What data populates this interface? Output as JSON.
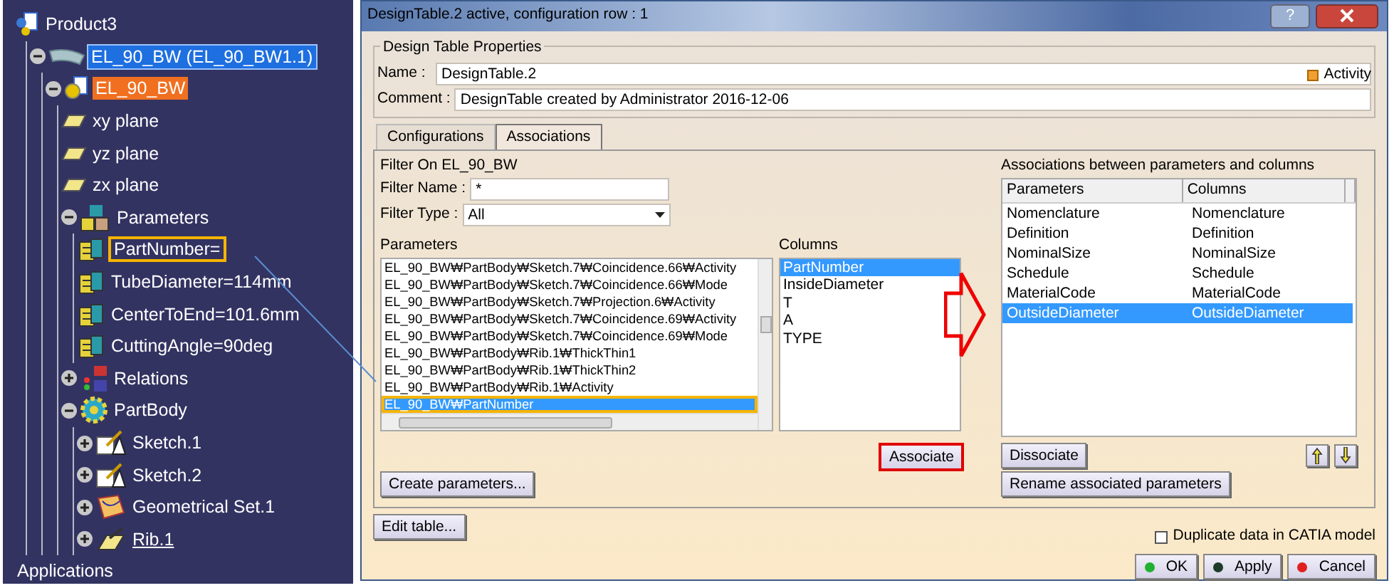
{
  "tree": [
    {
      "label": "Product3",
      "kind": "product",
      "selected": false,
      "highlighted": false,
      "children": [
        {
          "label": "EL_90_BW (EL_90_BW1.1)",
          "kind": "elbow",
          "expanded": true,
          "selected": true,
          "highlighted": false,
          "children": [
            {
              "label": "EL_90_BW",
              "kind": "part",
              "expanded": true,
              "selected": false,
              "highlighted": true,
              "children": [
                {
                  "label": "xy plane",
                  "kind": "plane",
                  "selected": false,
                  "highlighted": false
                },
                {
                  "label": "yz plane",
                  "kind": "plane",
                  "selected": false,
                  "highlighted": false
                },
                {
                  "label": "zx plane",
                  "kind": "plane",
                  "selected": false,
                  "highlighted": false
                },
                {
                  "label": "Parameters",
                  "kind": "parameters",
                  "expanded": true,
                  "selected": false,
                  "highlighted": false,
                  "children": [
                    {
                      "label": "PartNumber=",
                      "kind": "parameter",
                      "selected": false,
                      "highlighted": false,
                      "boxed": true
                    },
                    {
                      "label": "TubeDiameter=114mm",
                      "kind": "parameter",
                      "selected": false,
                      "highlighted": false
                    },
                    {
                      "label": "CenterToEnd=101.6mm",
                      "kind": "parameter",
                      "selected": false,
                      "highlighted": false
                    },
                    {
                      "label": "CuttingAngle=90deg",
                      "kind": "parameter",
                      "selected": false,
                      "highlighted": false
                    }
                  ]
                },
                {
                  "label": "Relations",
                  "kind": "relations",
                  "expanded": false,
                  "selected": false,
                  "highlighted": false
                },
                {
                  "label": "PartBody",
                  "kind": "body",
                  "expanded": true,
                  "selected": false,
                  "highlighted": false,
                  "children": [
                    {
                      "label": "Sketch.1",
                      "kind": "sketch",
                      "expanded": false,
                      "selected": false,
                      "highlighted": false
                    },
                    {
                      "label": "Sketch.2",
                      "kind": "sketch",
                      "expanded": false,
                      "selected": false,
                      "highlighted": false
                    },
                    {
                      "label": "Geometrical Set.1",
                      "kind": "geoset",
                      "expanded": false,
                      "selected": false,
                      "highlighted": false
                    },
                    {
                      "label": "Rib.1",
                      "kind": "rib",
                      "expanded": false,
                      "selected": false,
                      "highlighted": false,
                      "underlined": true
                    }
                  ]
                }
              ]
            }
          ]
        }
      ]
    },
    {
      "label": "Applications",
      "kind": "none",
      "selected": false,
      "highlighted": false
    }
  ],
  "dialog": {
    "title": "DesignTable.2 active, configuration row : 1",
    "help": "?",
    "properties": {
      "legend": "Design Table Properties",
      "name_label": "Name :",
      "name_value": "DesignTable.2",
      "comment_label": "Comment :",
      "comment_value": "DesignTable created by Administrator 2016-12-06",
      "activity": {
        "label": "Activity",
        "checked": true
      }
    },
    "tabs": [
      {
        "label": "Configurations",
        "selected": false
      },
      {
        "label": "Associations",
        "selected": true
      }
    ],
    "filter": {
      "caption": "Filter On EL_90_BW",
      "name_label": "Filter Name :",
      "name_value": "*",
      "type_label": "Filter Type :",
      "type_value": "All"
    },
    "parameters": {
      "label": "Parameters",
      "items": [
        {
          "text": "EL_90_BW₩PartBody₩Sketch.7₩Coincidence.66₩Activity",
          "selected": false,
          "boxed": false
        },
        {
          "text": "EL_90_BW₩PartBody₩Sketch.7₩Coincidence.66₩Mode",
          "selected": false,
          "boxed": false
        },
        {
          "text": "EL_90_BW₩PartBody₩Sketch.7₩Projection.6₩Activity",
          "selected": false,
          "boxed": false
        },
        {
          "text": "EL_90_BW₩PartBody₩Sketch.7₩Coincidence.69₩Activity",
          "selected": false,
          "boxed": false
        },
        {
          "text": "EL_90_BW₩PartBody₩Sketch.7₩Coincidence.69₩Mode",
          "selected": false,
          "boxed": false
        },
        {
          "text": "EL_90_BW₩PartBody₩Rib.1₩ThickThin1",
          "selected": false,
          "boxed": false
        },
        {
          "text": "EL_90_BW₩PartBody₩Rib.1₩ThickThin2",
          "selected": false,
          "boxed": false
        },
        {
          "text": "EL_90_BW₩PartBody₩Rib.1₩Activity",
          "selected": false,
          "boxed": false
        },
        {
          "text": "EL_90_BW₩PartNumber",
          "selected": true,
          "boxed": true
        }
      ]
    },
    "columns": {
      "label": "Columns",
      "items": [
        {
          "text": "PartNumber",
          "selected": true
        },
        {
          "text": "InsideDiameter",
          "selected": false
        },
        {
          "text": "T",
          "selected": false
        },
        {
          "text": "A",
          "selected": false
        },
        {
          "text": "TYPE",
          "selected": false
        }
      ]
    },
    "associate_button": {
      "label": "Associate",
      "boxed": true
    },
    "create_button": "Create parameters...",
    "associations": {
      "label": "Associations between parameters and columns",
      "headers": [
        "Parameters",
        "Columns"
      ],
      "rows": [
        {
          "parameter": "Nomenclature",
          "column": "Nomenclature",
          "selected": false
        },
        {
          "parameter": "Definition",
          "column": "Definition",
          "selected": false
        },
        {
          "parameter": "NominalSize",
          "column": "NominalSize",
          "selected": false
        },
        {
          "parameter": "Schedule",
          "column": "Schedule",
          "selected": false
        },
        {
          "parameter": "MaterialCode",
          "column": "MaterialCode",
          "selected": false
        },
        {
          "parameter": "OutsideDiameter",
          "column": "OutsideDiameter",
          "selected": true
        }
      ]
    },
    "dissociate_button": "Dissociate",
    "rename_button": "Rename associated parameters",
    "edit_button": "Edit table...",
    "duplicate": {
      "label": "Duplicate data in CATIA model",
      "checked": false
    },
    "buttons": [
      {
        "label": "OK",
        "kind": "ok"
      },
      {
        "label": "Apply",
        "kind": "apply"
      },
      {
        "label": "Cancel",
        "kind": "cancel"
      }
    ]
  }
}
